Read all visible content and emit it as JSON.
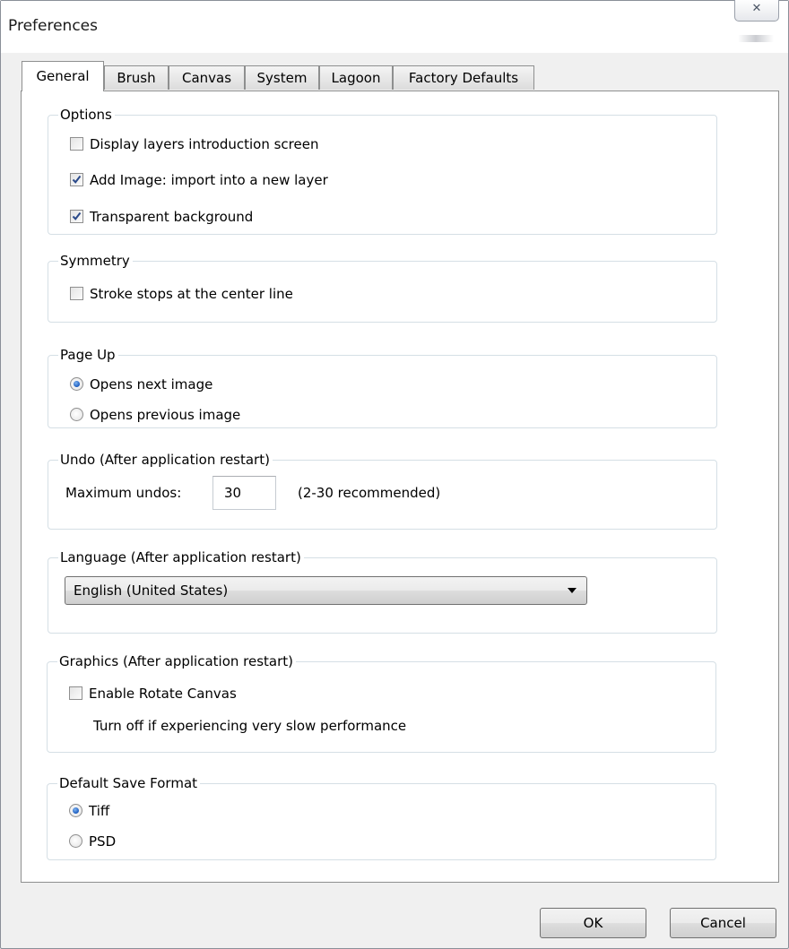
{
  "window": {
    "title": "Preferences",
    "close_glyph": "✕"
  },
  "tabs": [
    "General",
    "Brush",
    "Canvas",
    "System",
    "Lagoon",
    "Factory Defaults"
  ],
  "active_tab": "General",
  "options": {
    "legend": "Options",
    "items": [
      {
        "label": "Display layers introduction screen",
        "checked": false
      },
      {
        "label": "Add Image: import into a new layer",
        "checked": true
      },
      {
        "label": "Transparent background",
        "checked": true
      }
    ]
  },
  "symmetry": {
    "legend": "Symmetry",
    "items": [
      {
        "label": "Stroke stops at the center line",
        "checked": false
      }
    ]
  },
  "page_up": {
    "legend": "Page Up",
    "options": [
      {
        "label": "Opens next image",
        "selected": true
      },
      {
        "label": "Opens previous image",
        "selected": false
      }
    ]
  },
  "undo": {
    "legend": "Undo (After application restart)",
    "label": "Maximum undos:",
    "value": "30",
    "hint": "(2-30 recommended)"
  },
  "language": {
    "legend": "Language (After application restart)",
    "selected": "English (United States)"
  },
  "graphics": {
    "legend": "Graphics (After application restart)",
    "checkbox_label": "Enable  Rotate Canvas",
    "checked": false,
    "note": "Turn off if experiencing very slow performance"
  },
  "save_format": {
    "legend": "Default Save Format",
    "options": [
      {
        "label": "Tiff",
        "selected": true
      },
      {
        "label": "PSD",
        "selected": false
      }
    ]
  },
  "buttons": {
    "ok": "OK",
    "cancel": "Cancel"
  }
}
